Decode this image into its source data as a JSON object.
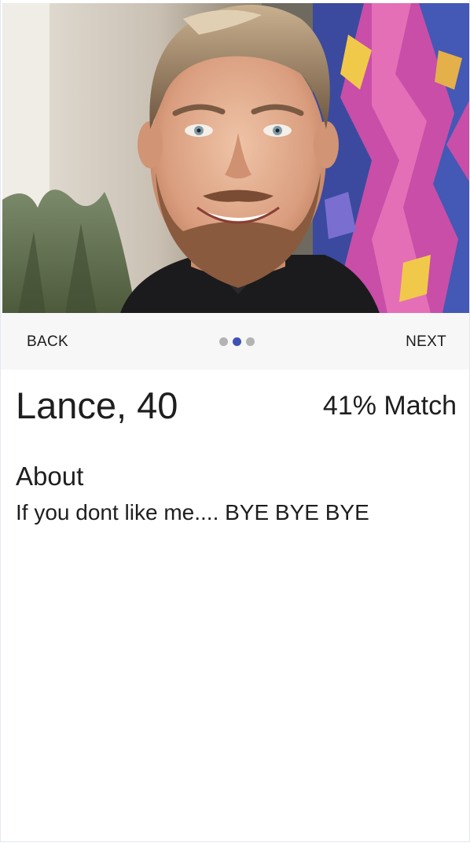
{
  "profile": {
    "photo_alt": "profile-photo",
    "name_age": "Lance, 40",
    "match": "41% Match",
    "about_heading": "About",
    "about_text": "If you dont like me.... BYE BYE BYE"
  },
  "stepper": {
    "back_label": "BACK",
    "next_label": "NEXT",
    "steps": 3,
    "active_step": 2
  },
  "colors": {
    "accent": "#3f51b5",
    "dot_inactive": "#b3b3b3",
    "stepper_bg": "#f7f7f7",
    "text": "#1e1e1e"
  }
}
